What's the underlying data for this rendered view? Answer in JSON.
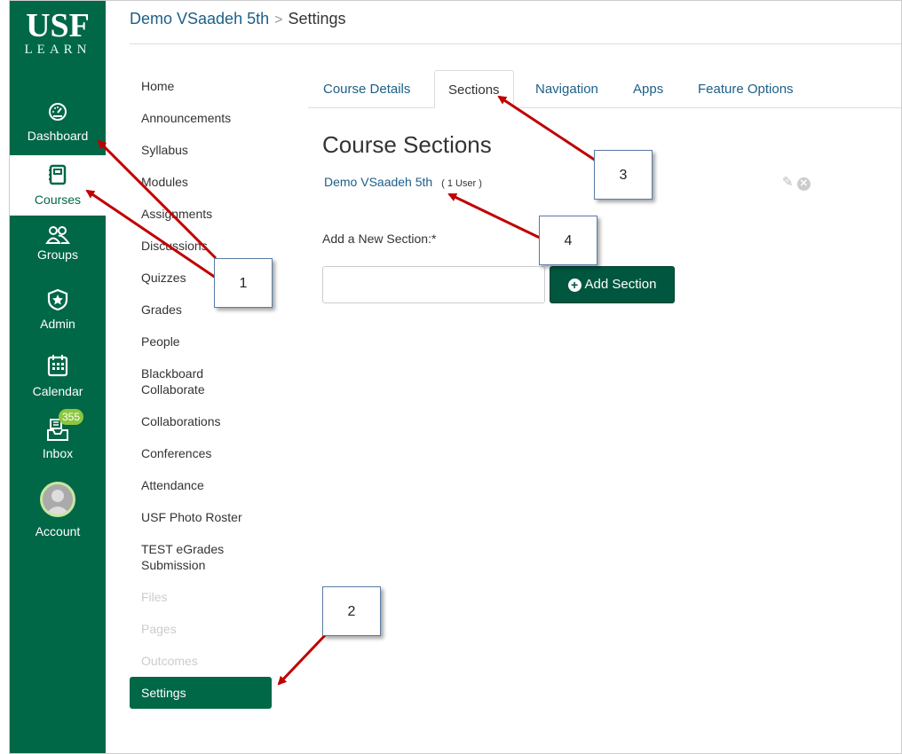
{
  "logo": {
    "top": "USF",
    "bottom": "LEARN"
  },
  "global_nav": [
    {
      "label": "Dashboard",
      "icon": "dashboard-icon"
    },
    {
      "label": "Courses",
      "icon": "courses-icon"
    },
    {
      "label": "Groups",
      "icon": "groups-icon"
    },
    {
      "label": "Admin",
      "icon": "admin-icon"
    },
    {
      "label": "Calendar",
      "icon": "calendar-icon"
    },
    {
      "label": "Inbox",
      "icon": "inbox-icon",
      "badge": "355"
    },
    {
      "label": "Account",
      "icon": "avatar"
    }
  ],
  "breadcrumb": {
    "course": "Demo VSaadeh 5th",
    "separator": ">",
    "current": "Settings"
  },
  "course_nav": [
    {
      "label": "Home"
    },
    {
      "label": "Announcements"
    },
    {
      "label": "Syllabus"
    },
    {
      "label": "Modules"
    },
    {
      "label": "Assignments"
    },
    {
      "label": "Discussions"
    },
    {
      "label": "Quizzes"
    },
    {
      "label": "Grades"
    },
    {
      "label": "People"
    },
    {
      "label": "Blackboard Collaborate"
    },
    {
      "label": "Collaborations"
    },
    {
      "label": "Conferences"
    },
    {
      "label": "Attendance"
    },
    {
      "label": "USF Photo Roster"
    },
    {
      "label": "TEST eGrades Submission"
    },
    {
      "label": "Files"
    },
    {
      "label": "Pages"
    },
    {
      "label": "Outcomes"
    },
    {
      "label": "Settings"
    }
  ],
  "tabs": [
    {
      "label": "Course Details"
    },
    {
      "label": "Sections"
    },
    {
      "label": "Navigation"
    },
    {
      "label": "Apps"
    },
    {
      "label": "Feature Options"
    }
  ],
  "main": {
    "heading": "Course Sections",
    "section_name": "Demo VSaadeh 5th",
    "section_count": "( 1 User )",
    "add_label": "Add a New Section:*",
    "add_button": "Add Section"
  },
  "callouts": [
    "1",
    "2",
    "3",
    "4"
  ],
  "colors": {
    "brand": "#006747",
    "link": "#1c5f88",
    "badge": "#8dc63f",
    "arrow": "#c00000"
  }
}
